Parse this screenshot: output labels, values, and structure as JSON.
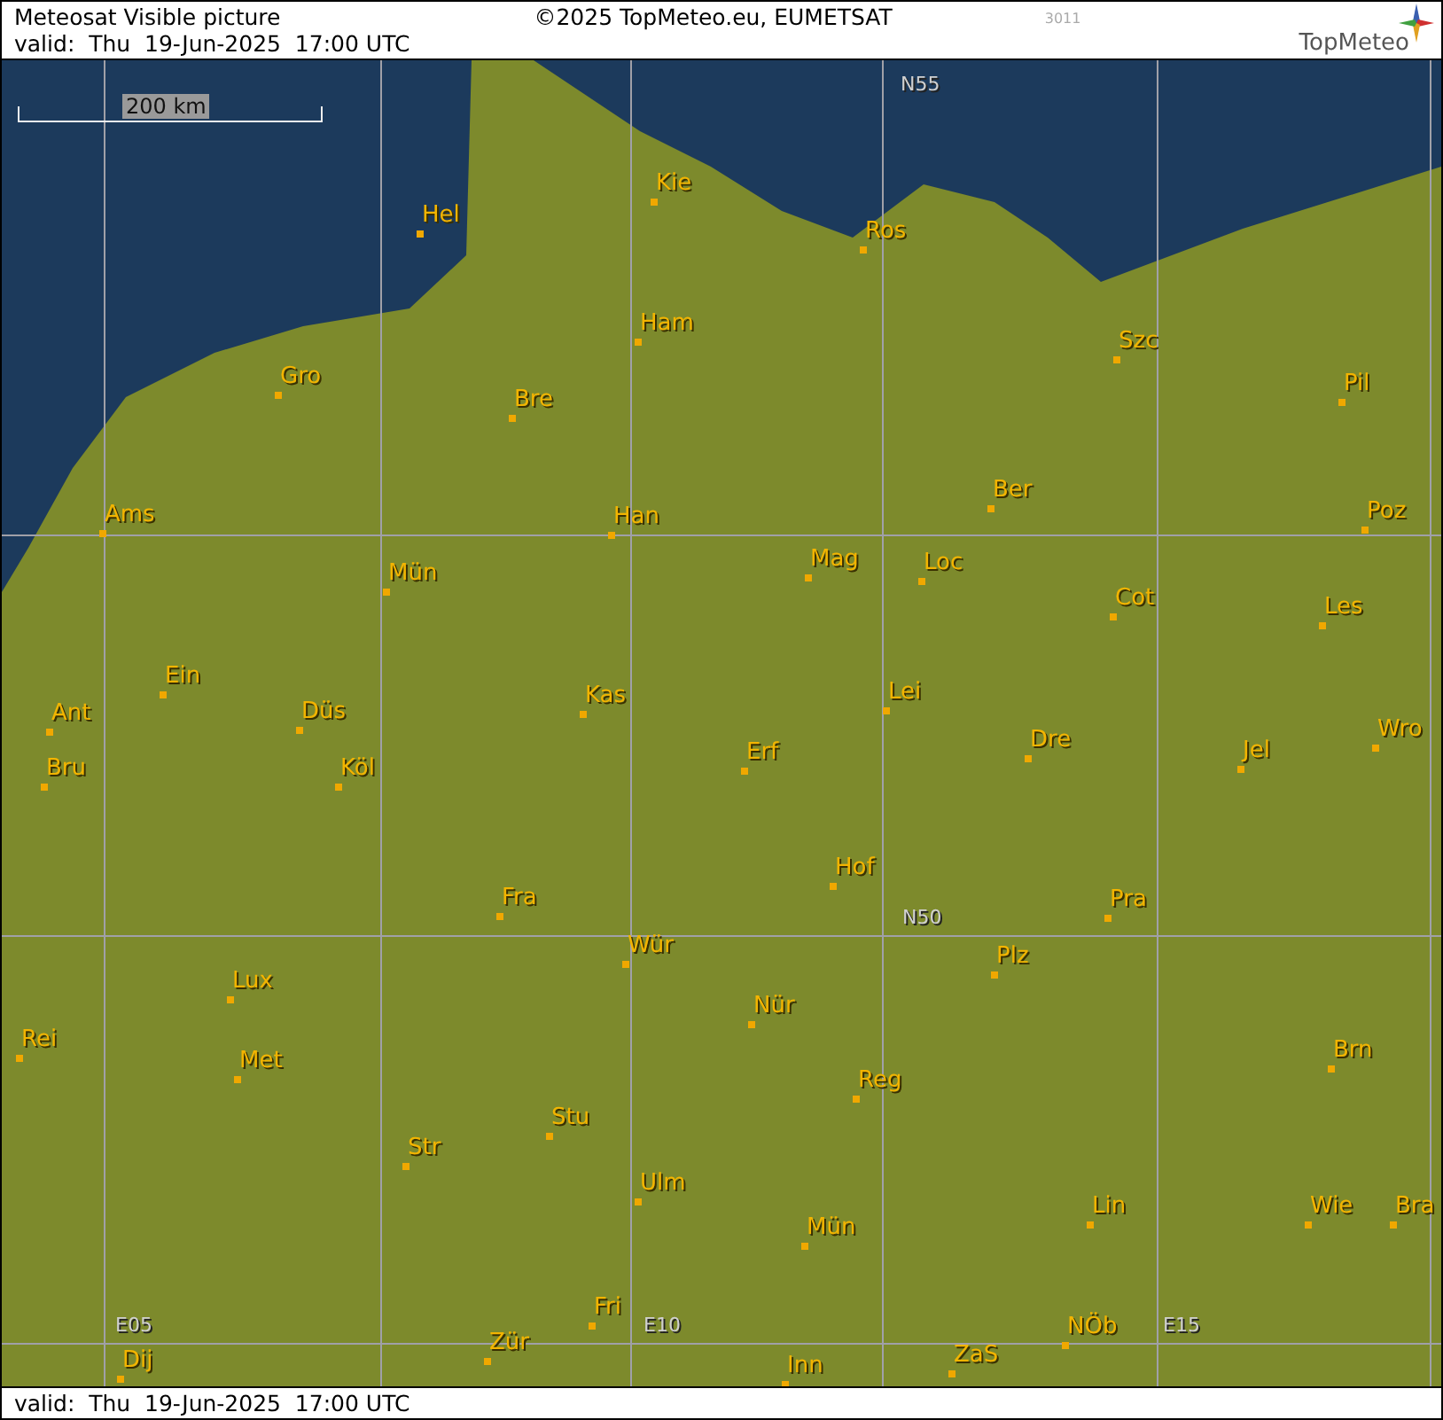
{
  "header": {
    "title": "Meteosat Visible picture",
    "valid": "valid:  Thu  19-Jun-2025  17:00 UTC",
    "copyright": "©2025 TopMeteo.eu, EUMETSAT",
    "code": "3011",
    "logo": "TopMeteo"
  },
  "scale": "200 km",
  "grid_labels": [
    "N55",
    "N50",
    "E05",
    "E10",
    "E15"
  ],
  "cities": [
    "Hel",
    "Kie",
    "Ros",
    "Ham",
    "Gro",
    "Bre",
    "Szc",
    "Pil",
    "Ams",
    "Han",
    "Ber",
    "Mag",
    "Loc",
    "Poz",
    "Mün",
    "Cot",
    "Les",
    "Ein",
    "Kas",
    "Lei",
    "Ant",
    "Düs",
    "Dre",
    "Wro",
    "Bru",
    "Köl",
    "Erf",
    "Jel",
    "Hof",
    "Fra",
    "Pra",
    "Wür",
    "Plz",
    "Lux",
    "Nür",
    "Rei",
    "Met",
    "Reg",
    "Stu",
    "Str",
    "Brn",
    "Ulm",
    "Lin",
    "Mün",
    "Wie",
    "Bra",
    "Fri",
    "Dij",
    "Zür",
    "Inn",
    "ZaS",
    "NÖb"
  ],
  "footer": {
    "valid": "valid:  Thu  19-Jun-2025  17:00 UTC"
  }
}
